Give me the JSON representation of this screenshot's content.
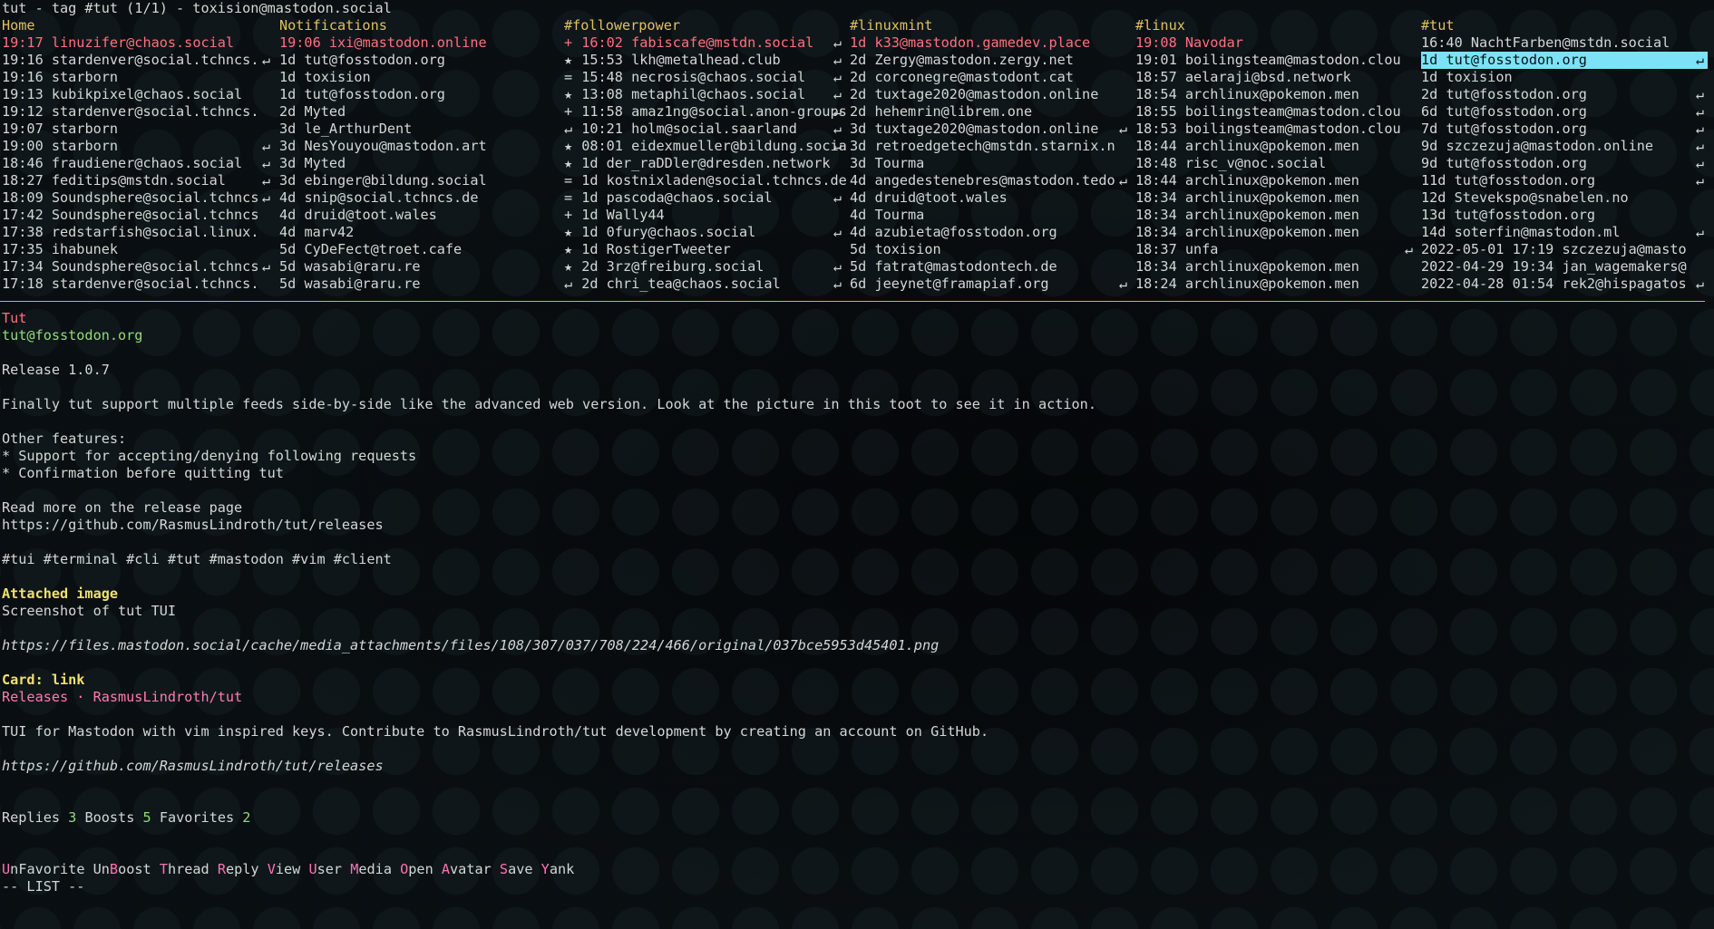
{
  "window_title": "tut - tag #tut (1/1) - toxision@mastodon.social",
  "columns": [
    {
      "title": "Home",
      "rows": [
        {
          "mark": "",
          "time": "19:17",
          "user": "linuzifer@chaos.social",
          "reply": "",
          "hot": true
        },
        {
          "mark": "",
          "time": "19:16",
          "user": "stardenver@social.tchncs.",
          "reply": "↵"
        },
        {
          "mark": "",
          "time": "19:16",
          "user": "starborn",
          "reply": ""
        },
        {
          "mark": "",
          "time": "19:13",
          "user": "kubikpixel@chaos.social",
          "reply": ""
        },
        {
          "mark": "",
          "time": "19:12",
          "user": "stardenver@social.tchncs.",
          "reply": ""
        },
        {
          "mark": "",
          "time": "19:07",
          "user": "starborn",
          "reply": ""
        },
        {
          "mark": "",
          "time": "19:00",
          "user": "starborn",
          "reply": "↵"
        },
        {
          "mark": "",
          "time": "18:46",
          "user": "fraudiener@chaos.social",
          "reply": "↵"
        },
        {
          "mark": "",
          "time": "18:27",
          "user": "feditips@mstdn.social",
          "reply": "↵"
        },
        {
          "mark": "",
          "time": "18:09",
          "user": "Soundsphere@social.tchncs",
          "reply": "↵"
        },
        {
          "mark": "",
          "time": "17:42",
          "user": "Soundsphere@social.tchncs",
          "reply": ""
        },
        {
          "mark": "",
          "time": "17:38",
          "user": "redstarfish@social.linux.",
          "reply": ""
        },
        {
          "mark": "",
          "time": "17:35",
          "user": "ihabunek",
          "reply": ""
        },
        {
          "mark": "",
          "time": "17:34",
          "user": "Soundsphere@social.tchncs",
          "reply": "↵"
        },
        {
          "mark": "",
          "time": "17:18",
          "user": "stardenver@social.tchncs.",
          "reply": ""
        }
      ]
    },
    {
      "title": "Notifications",
      "rows": [
        {
          "mark": "",
          "time": "19:06",
          "user": "ixi@mastodon.online",
          "reply": "",
          "hot": true
        },
        {
          "mark": "",
          "time": "1d",
          "user": "tut@fosstodon.org",
          "reply": ""
        },
        {
          "mark": "",
          "time": "1d",
          "user": "toxision",
          "reply": ""
        },
        {
          "mark": "",
          "time": "1d",
          "user": "tut@fosstodon.org",
          "reply": ""
        },
        {
          "mark": "",
          "time": "2d",
          "user": "Myted",
          "reply": ""
        },
        {
          "mark": "",
          "time": "3d",
          "user": "le_ArthurDent",
          "reply": ""
        },
        {
          "mark": "",
          "time": "3d",
          "user": "NesYouyou@mastodon.art",
          "reply": ""
        },
        {
          "mark": "",
          "time": "3d",
          "user": "Myted",
          "reply": ""
        },
        {
          "mark": "",
          "time": "3d",
          "user": "ebinger@bildung.social",
          "reply": ""
        },
        {
          "mark": "",
          "time": "4d",
          "user": "snip@social.tchncs.de",
          "reply": ""
        },
        {
          "mark": "",
          "time": "4d",
          "user": "druid@toot.wales",
          "reply": ""
        },
        {
          "mark": "",
          "time": "4d",
          "user": "marv42",
          "reply": ""
        },
        {
          "mark": "",
          "time": "5d",
          "user": "CyDeFect@troet.cafe",
          "reply": ""
        },
        {
          "mark": "",
          "time": "5d",
          "user": "wasabi@raru.re",
          "reply": ""
        },
        {
          "mark": "",
          "time": "5d",
          "user": "wasabi@raru.re",
          "reply": ""
        }
      ]
    },
    {
      "title": "#followerpower",
      "rows": [
        {
          "mark": "+",
          "time": "16:02",
          "user": "fabiscafe@mstdn.social",
          "reply": "↵",
          "hot": true
        },
        {
          "mark": "★",
          "time": "15:53",
          "user": "lkh@metalhead.club",
          "reply": "↵"
        },
        {
          "mark": "=",
          "time": "15:48",
          "user": "necrosis@chaos.social",
          "reply": "↵"
        },
        {
          "mark": "★",
          "time": "13:08",
          "user": "metaphil@chaos.social",
          "reply": "↵"
        },
        {
          "mark": "+",
          "time": "11:58",
          "user": "amaz1ng@social.anon-groups",
          "reply": "↵"
        },
        {
          "mark": "↵",
          "time": "10:21",
          "user": "holm@social.saarland",
          "reply": "↵"
        },
        {
          "mark": "★",
          "time": "08:01",
          "user": "eidexmueller@bildung.socia",
          "reply": "↵"
        },
        {
          "mark": "★",
          "time": "1d",
          "user": "der_raDDler@dresden.network",
          "reply": ""
        },
        {
          "mark": "=",
          "time": "1d",
          "user": "kostnixladen@social.tchncs.de",
          "reply": ""
        },
        {
          "mark": "=",
          "time": "1d",
          "user": "pascoda@chaos.social",
          "reply": "↵"
        },
        {
          "mark": "+",
          "time": "1d",
          "user": "Wally44",
          "reply": ""
        },
        {
          "mark": "★",
          "time": "1d",
          "user": "0fury@chaos.social",
          "reply": "↵"
        },
        {
          "mark": "★",
          "time": "1d",
          "user": "RostigerTweeter",
          "reply": ""
        },
        {
          "mark": "★",
          "time": "2d",
          "user": "3rz@freiburg.social",
          "reply": "↵"
        },
        {
          "mark": "↵",
          "time": "2d",
          "user": "chri_tea@chaos.social",
          "reply": "↵"
        }
      ]
    },
    {
      "title": "#linuxmint",
      "rows": [
        {
          "mark": "",
          "time": "1d",
          "user": "k33@mastodon.gamedev.place",
          "reply": "",
          "hot": true
        },
        {
          "mark": "",
          "time": "2d",
          "user": "Zergy@mastodon.zergy.net",
          "reply": ""
        },
        {
          "mark": "",
          "time": "2d",
          "user": "corconegre@mastodont.cat",
          "reply": ""
        },
        {
          "mark": "",
          "time": "2d",
          "user": "tuxtage2020@mastodon.online",
          "reply": ""
        },
        {
          "mark": "",
          "time": "2d",
          "user": "hehemrin@librem.one",
          "reply": ""
        },
        {
          "mark": "",
          "time": "3d",
          "user": "tuxtage2020@mastodon.online",
          "reply": "↵"
        },
        {
          "mark": "",
          "time": "3d",
          "user": "retroedgetech@mstdn.starnix.n",
          "reply": ""
        },
        {
          "mark": "",
          "time": "3d",
          "user": "Tourma",
          "reply": ""
        },
        {
          "mark": "",
          "time": "4d",
          "user": "angedestenebres@mastodon.tedo",
          "reply": "↵"
        },
        {
          "mark": "",
          "time": "4d",
          "user": "druid@toot.wales",
          "reply": ""
        },
        {
          "mark": "",
          "time": "4d",
          "user": "Tourma",
          "reply": ""
        },
        {
          "mark": "",
          "time": "4d",
          "user": "azubieta@fosstodon.org",
          "reply": ""
        },
        {
          "mark": "",
          "time": "5d",
          "user": "toxision",
          "reply": ""
        },
        {
          "mark": "",
          "time": "5d",
          "user": "fatrat@mastodontech.de",
          "reply": ""
        },
        {
          "mark": "",
          "time": "6d",
          "user": "jeeynet@framapiaf.org",
          "reply": "↵"
        }
      ]
    },
    {
      "title": "#linux",
      "rows": [
        {
          "mark": "",
          "time": "19:08",
          "user": "Navodar",
          "reply": "",
          "hot": true
        },
        {
          "mark": "",
          "time": "19:01",
          "user": "boilingsteam@mastodon.clou",
          "reply": ""
        },
        {
          "mark": "",
          "time": "18:57",
          "user": "aelaraji@bsd.network",
          "reply": ""
        },
        {
          "mark": "",
          "time": "18:54",
          "user": "archlinux@pokemon.men",
          "reply": ""
        },
        {
          "mark": "",
          "time": "18:55",
          "user": "boilingsteam@mastodon.clou",
          "reply": ""
        },
        {
          "mark": "",
          "time": "18:53",
          "user": "boilingsteam@mastodon.clou",
          "reply": ""
        },
        {
          "mark": "",
          "time": "18:44",
          "user": "archlinux@pokemon.men",
          "reply": ""
        },
        {
          "mark": "",
          "time": "18:48",
          "user": "risc_v@noc.social",
          "reply": ""
        },
        {
          "mark": "",
          "time": "18:44",
          "user": "archlinux@pokemon.men",
          "reply": ""
        },
        {
          "mark": "",
          "time": "18:34",
          "user": "archlinux@pokemon.men",
          "reply": ""
        },
        {
          "mark": "",
          "time": "18:34",
          "user": "archlinux@pokemon.men",
          "reply": ""
        },
        {
          "mark": "",
          "time": "18:34",
          "user": "archlinux@pokemon.men",
          "reply": ""
        },
        {
          "mark": "",
          "time": "18:37",
          "user": "unfa",
          "reply": "↵"
        },
        {
          "mark": "",
          "time": "18:34",
          "user": "archlinux@pokemon.men",
          "reply": ""
        },
        {
          "mark": "",
          "time": "18:24",
          "user": "archlinux@pokemon.men",
          "reply": ""
        }
      ]
    },
    {
      "title": "#tut",
      "rows": [
        {
          "mark": "",
          "time": "16:40",
          "user": "NachtFarben@mstdn.social",
          "reply": ""
        },
        {
          "mark": "",
          "time": "1d",
          "user": "tut@fosstodon.org",
          "reply": "↵",
          "selected": true
        },
        {
          "mark": "",
          "time": "1d",
          "user": "toxision",
          "reply": ""
        },
        {
          "mark": "",
          "time": "2d",
          "user": "tut@fosstodon.org",
          "reply": "↵"
        },
        {
          "mark": "",
          "time": "6d",
          "user": "tut@fosstodon.org",
          "reply": "↵"
        },
        {
          "mark": "",
          "time": "7d",
          "user": "tut@fosstodon.org",
          "reply": "↵"
        },
        {
          "mark": "",
          "time": "9d",
          "user": "szczezuja@mastodon.online",
          "reply": "↵"
        },
        {
          "mark": "",
          "time": "9d",
          "user": "tut@fosstodon.org",
          "reply": "↵"
        },
        {
          "mark": "",
          "time": "11d",
          "user": "tut@fosstodon.org",
          "reply": "↵"
        },
        {
          "mark": "",
          "time": "12d",
          "user": "Stevekspo@snabelen.no",
          "reply": ""
        },
        {
          "mark": "",
          "time": "13d",
          "user": "tut@fosstodon.org",
          "reply": ""
        },
        {
          "mark": "",
          "time": "14d",
          "user": "soterfin@mastodon.ml",
          "reply": "↵"
        },
        {
          "mark": "",
          "time": "2022-05-01 17:19",
          "user": "szczezuja@masto",
          "reply": ""
        },
        {
          "mark": "",
          "time": "2022-04-29 19:34",
          "user": "jan_wagemakers@",
          "reply": ""
        },
        {
          "mark": "",
          "time": "2022-04-28 01:54",
          "user": "rek2@hispagatos",
          "reply": "↵"
        }
      ]
    }
  ],
  "toot": {
    "display_name": "Tut",
    "account": "tut@fosstodon.org",
    "lines": [
      "Release 1.0.7",
      "",
      "Finally tut support multiple feeds side-by-side like the advanced web version. Look at the picture in this toot to see it in action.",
      "",
      "Other features:",
      "* Support for accepting/denying following requests",
      "* Confirmation before quitting tut",
      "",
      "Read more on the release page",
      "https://github.com/RasmusLindroth/tut/releases",
      "",
      "#tui #terminal #cli #tut #mastodon #vim #client"
    ],
    "attachment_heading": "Attached image",
    "attachment_desc": "Screenshot of tut TUI",
    "attachment_url": "https://files.mastodon.social/cache/media_attachments/files/108/307/037/708/224/466/original/037bce5953d45401.png",
    "card_heading": "Card: link",
    "card_title": "Releases · RasmusLindroth/tut",
    "card_desc": "TUI for Mastodon with vim inspired keys. Contribute to RasmusLindroth/tut development by creating an account on GitHub.",
    "card_url": "https://github.com/RasmusLindroth/tut/releases",
    "stats": {
      "replies_label": "Replies",
      "replies": "3",
      "boosts_label": "Boosts",
      "boosts": "5",
      "favorites_label": "Favorites",
      "favorites": "2"
    }
  },
  "actions": [
    {
      "key": "U",
      "rest": "n",
      "tail": "Favorite"
    },
    {
      "key": "",
      "rest": "Un",
      "keymid": "B",
      "tail": "oost"
    },
    {
      "key": "T",
      "rest": "",
      "tail": "hread"
    },
    {
      "key": "R",
      "rest": "",
      "tail": "eply"
    },
    {
      "key": "V",
      "rest": "",
      "tail": "iew"
    },
    {
      "key": "U",
      "rest": "",
      "tail": "ser"
    },
    {
      "key": "M",
      "rest": "",
      "tail": "edia"
    },
    {
      "key": "O",
      "rest": "",
      "tail": "pen"
    },
    {
      "key": "A",
      "rest": "",
      "tail": "vatar"
    },
    {
      "key": "S",
      "rest": "",
      "tail": "ave"
    },
    {
      "key": "Y",
      "rest": "",
      "tail": "ank"
    }
  ],
  "mode": "-- LIST --"
}
